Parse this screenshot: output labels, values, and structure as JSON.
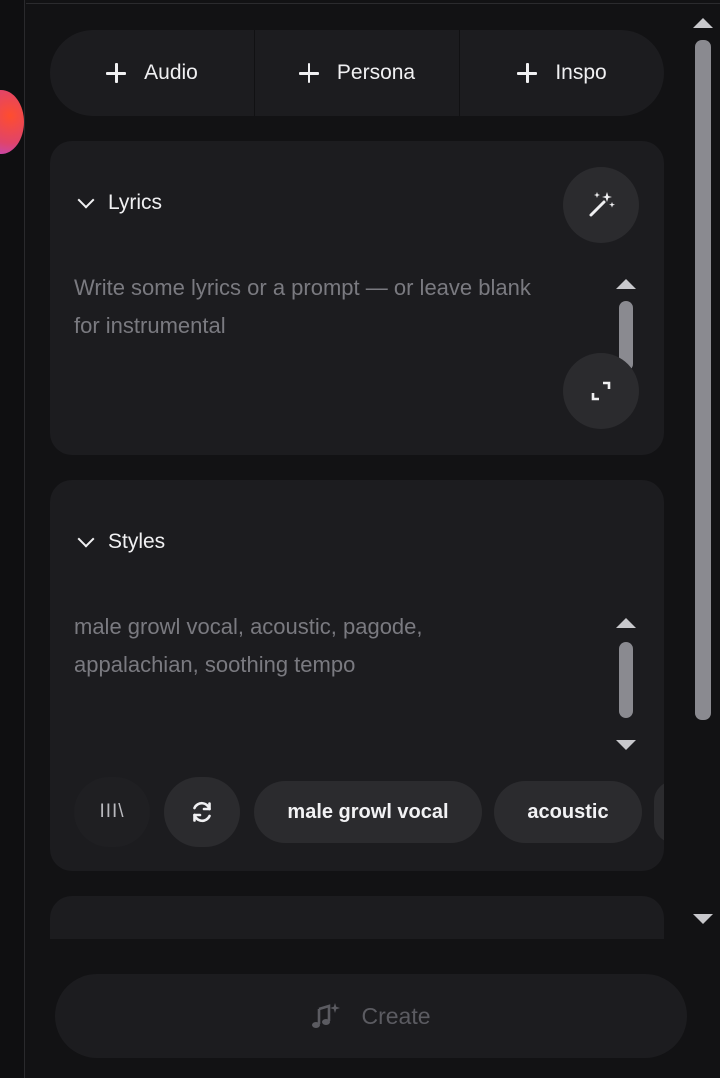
{
  "add_bar": {
    "audio_label": "Audio",
    "persona_label": "Persona",
    "inspo_label": "Inspo"
  },
  "lyrics": {
    "title": "Lyrics",
    "placeholder_line1": "Write some lyrics or a prompt — or leave blank",
    "placeholder_line2": "for instrumental",
    "icons": [
      "magic-wand-icon",
      "expand-icon",
      "chevron-down-icon"
    ]
  },
  "styles": {
    "title": "Styles",
    "text_line1": "male growl vocal, acoustic, pagode,",
    "text_line2": "appalachian, soothing tempo",
    "library_icon_text": "III\\",
    "chips": [
      "male growl vocal",
      "acoustic"
    ],
    "icons": [
      "library-icon",
      "refresh-icon"
    ]
  },
  "create": {
    "label": "Create",
    "icon": "music-sparkle-icon"
  },
  "colors": {
    "background": "#121214",
    "card": "#1c1c1f",
    "button": "#2b2b2e",
    "placeholder": "#7a7a80",
    "disabled": "#5b5b61"
  }
}
